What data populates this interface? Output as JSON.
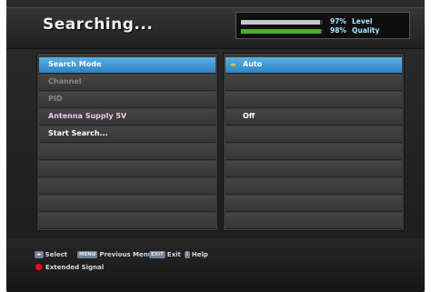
{
  "screen": {
    "title": "Searching..."
  },
  "signal": {
    "level": {
      "percent_label": "97%",
      "label": "Level",
      "value": 0.97,
      "color": "#c8c8c8"
    },
    "quality": {
      "percent_label": "98%",
      "label": "Quality",
      "value": 0.98,
      "color": "#4caf2a"
    }
  },
  "menu": {
    "items": [
      {
        "label": "Search Mode",
        "style": "selected",
        "value": "Auto"
      },
      {
        "label": "Channel",
        "style": "dim",
        "value": ""
      },
      {
        "label": "PID",
        "style": "dim",
        "value": ""
      },
      {
        "label": "Antenna Supply 5V",
        "style": "pink",
        "value": "Off"
      },
      {
        "label": "Start Search...",
        "style": "normal",
        "value": ""
      }
    ]
  },
  "footer": {
    "hints": [
      {
        "key": "◂▸",
        "label": "Select"
      },
      {
        "key": "MENU",
        "label": "Previous Menu"
      },
      {
        "key": "EXIT",
        "label": "Exit"
      },
      {
        "key": "i",
        "label": "Help"
      }
    ],
    "red_label": "Extended Signal"
  },
  "colors": {
    "accent": "#3a95d6",
    "selected_arrow": "#f3c33a",
    "red_button": "#d01b1b"
  }
}
